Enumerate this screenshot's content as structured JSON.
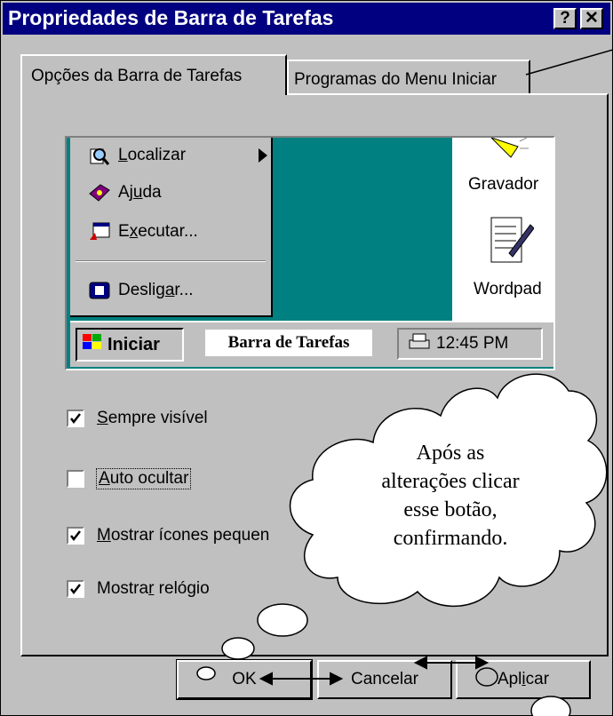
{
  "window": {
    "title": "Propriedades de Barra de Tarefas",
    "help_button": "?",
    "close_button": "✕"
  },
  "tabs": [
    {
      "label": "Opções da Barra de Tarefas",
      "active": true
    },
    {
      "label": "Programas do Menu Iniciar",
      "active": false
    }
  ],
  "preview": {
    "menu_items": [
      {
        "pre": "",
        "accel": "L",
        "post": "ocalizar",
        "icon": "magnifier-icon",
        "submenu": true
      },
      {
        "pre": "Aj",
        "accel": "u",
        "post": "da",
        "icon": "help-book-icon"
      },
      {
        "pre": "E",
        "accel": "x",
        "post": "ecutar...",
        "icon": "run-icon"
      },
      {
        "pre": "Deslig",
        "accel": "a",
        "post": "r...",
        "icon": "shutdown-icon"
      }
    ],
    "desktop_icons": [
      "Gravador",
      "Wordpad"
    ],
    "start_button": "Iniciar",
    "taskbar_label": "Barra de Tarefas",
    "clock": "12:45 PM"
  },
  "options": [
    {
      "pre": "",
      "accel": "S",
      "post": "empre visível",
      "checked": true
    },
    {
      "pre": "",
      "accel": "A",
      "post": "uto ocultar",
      "checked": false
    },
    {
      "pre": "",
      "accel": "M",
      "post": "ostrar ícones pequen",
      "checked": true
    },
    {
      "pre": "Mostra",
      "accel": "r",
      "post": " relógio",
      "checked": true
    }
  ],
  "buttons": {
    "ok": "OK",
    "cancel": "Cancelar",
    "apply_pre": "Apl",
    "apply_accel": "i",
    "apply_post": "car"
  },
  "callout": {
    "lines": [
      "Após as",
      "alterações clicar",
      "esse botão,",
      "confirmando."
    ]
  },
  "colors": {
    "titlebar": "#000080",
    "face": "#c0c0c0",
    "desktop": "#008080"
  }
}
